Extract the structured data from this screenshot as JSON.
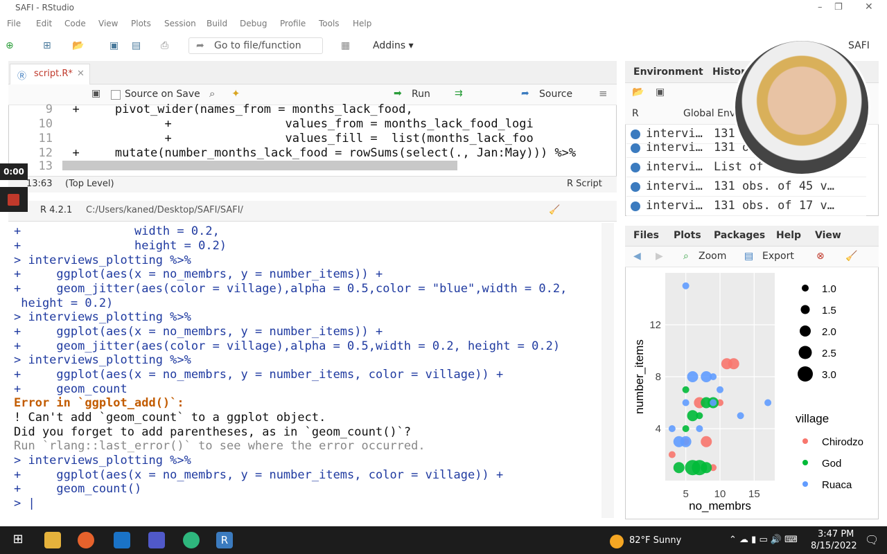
{
  "window": {
    "title": "SAFI - RStudio"
  },
  "menu": [
    "File",
    "Edit",
    "Code",
    "View",
    "Plots",
    "Session",
    "Build",
    "Debug",
    "Profile",
    "Tools",
    "Help"
  ],
  "toolbar": {
    "goto_placeholder": "Go to file/function",
    "addins": "Addins",
    "project": "SAFI"
  },
  "editor": {
    "tab": "script.R*",
    "source_on_save": "Source on Save",
    "run": "Run",
    "source": "Source",
    "lines": [
      {
        "n": "9",
        "text": "  +     pivot_wider(names_from = months_lack_food,"
      },
      {
        "n": "10",
        "text": "               +                values_from = months_lack_food_logi"
      },
      {
        "n": "11",
        "text": "               +                values_fill =  list(months_lack_foo"
      },
      {
        "n": "12",
        "text": "  +     mutate(number_months_lack_food = rowSums(select(., Jan:May))) %>%"
      },
      {
        "n": "13",
        "text": ""
      }
    ],
    "status_pos": "13:63",
    "status_level": "(Top Level)",
    "status_type": "R Script"
  },
  "console": {
    "version": "R 4.2.1",
    "path": "C:/Users/kaned/Desktop/SAFI/SAFI/",
    "lines": [
      {
        "cls": "prompt",
        "text": "+                width = 0.2,"
      },
      {
        "cls": "prompt",
        "text": "+                height = 0.2)"
      },
      {
        "cls": "prompt",
        "text": "> interviews_plotting %>%"
      },
      {
        "cls": "prompt",
        "text": "+     ggplot(aes(x = no_membrs, y = number_items)) +"
      },
      {
        "cls": "prompt",
        "text": "+     geom_jitter(aes(color = village),alpha = 0.5,color = \"blue\",width = 0.2,"
      },
      {
        "cls": "prompt",
        "text": " height = 0.2)"
      },
      {
        "cls": "prompt",
        "text": "> interviews_plotting %>%"
      },
      {
        "cls": "prompt",
        "text": "+     ggplot(aes(x = no_membrs, y = number_items)) +"
      },
      {
        "cls": "prompt",
        "text": "+     geom_jitter(aes(color = village),alpha = 0.5,width = 0.2, height = 0.2)"
      },
      {
        "cls": "prompt",
        "text": "> interviews_plotting %>%"
      },
      {
        "cls": "prompt",
        "text": "+     ggplot(aes(x = no_membrs, y = number_items, color = village)) +"
      },
      {
        "cls": "prompt",
        "text": "+     geom_count"
      },
      {
        "cls": "err",
        "text": "Error in `ggplot_add()`:"
      },
      {
        "cls": "errmsg",
        "text": "! Can't add `geom_count` to a ggplot object."
      },
      {
        "cls": "errmsg",
        "text": "Did you forget to add parentheses, as in `geom_count()`?"
      },
      {
        "cls": "gray",
        "text": "Run `rlang::last_error()` to see where the error occurred."
      },
      {
        "cls": "prompt",
        "text": "> interviews_plotting %>%"
      },
      {
        "cls": "prompt",
        "text": "+     ggplot(aes(x = no_membrs, y = number_items, color = village)) +"
      },
      {
        "cls": "prompt",
        "text": "+     geom_count()"
      },
      {
        "cls": "prompt",
        "text": "> |"
      }
    ]
  },
  "env": {
    "tabs": [
      "Environment",
      "History"
    ],
    "r_select": "R",
    "scope": "Global Env",
    "rows": [
      {
        "name": "intervi…",
        "value": "131"
      },
      {
        "name": "intervi…",
        "value": "131 o"
      },
      {
        "name": "intervi…",
        "value": "List of"
      },
      {
        "name": "intervi…",
        "value": "131 obs. of 45 v…"
      },
      {
        "name": "intervi…",
        "value": "131 obs. of 17 v…"
      }
    ]
  },
  "plots_pane": {
    "tabs": [
      "Files",
      "Plots",
      "Packages",
      "Help",
      "View"
    ],
    "zoom": "Zoom",
    "export": "Export"
  },
  "chart_data": {
    "type": "scatter",
    "xlabel": "no_membrs",
    "ylabel": "number_items",
    "xticks": [
      "5",
      "10",
      "15"
    ],
    "yticks": [
      "4",
      "8",
      "12"
    ],
    "size_legend": {
      "values": [
        "1.0",
        "1.5",
        "2.0",
        "2.5",
        "3.0"
      ]
    },
    "legend_title": "village",
    "series": [
      {
        "name": "Chirodzo",
        "color": "#F8766D",
        "points": [
          [
            11,
            9,
            2
          ],
          [
            12,
            9,
            2
          ],
          [
            7,
            6,
            2
          ],
          [
            10,
            6,
            1
          ],
          [
            3,
            2,
            1
          ],
          [
            8,
            3,
            2
          ],
          [
            9,
            1,
            1
          ],
          [
            5,
            3,
            1
          ]
        ]
      },
      {
        "name": "God",
        "color": "#00BA38",
        "points": [
          [
            5,
            7,
            1
          ],
          [
            7,
            1,
            3
          ],
          [
            6,
            5,
            2
          ],
          [
            8,
            6,
            2
          ],
          [
            9,
            6,
            2
          ],
          [
            4,
            1,
            2
          ],
          [
            7,
            5,
            1
          ],
          [
            6,
            1,
            3
          ],
          [
            8,
            1,
            2
          ],
          [
            5,
            4,
            1
          ]
        ]
      },
      {
        "name": "Ruaca",
        "color": "#619CFF",
        "points": [
          [
            5,
            6,
            1
          ],
          [
            6,
            8,
            2
          ],
          [
            8,
            8,
            2
          ],
          [
            9,
            8,
            1
          ],
          [
            4,
            3,
            2
          ],
          [
            5,
            3,
            2
          ],
          [
            3,
            4,
            1
          ],
          [
            7,
            4,
            1
          ],
          [
            9,
            6,
            1
          ],
          [
            10,
            7,
            1
          ],
          [
            5,
            15,
            1
          ],
          [
            13,
            5,
            1
          ],
          [
            17,
            6,
            1
          ]
        ]
      }
    ],
    "xlim": [
      2,
      18
    ],
    "ylim": [
      0,
      16
    ]
  },
  "taskbar": {
    "weather": "82°F  Sunny",
    "time": "3:47 PM",
    "date": "8/15/2022"
  },
  "video": {
    "time": "0:00"
  },
  "colors": {
    "accent": "#3b7bbf",
    "error": "#c25b00"
  }
}
